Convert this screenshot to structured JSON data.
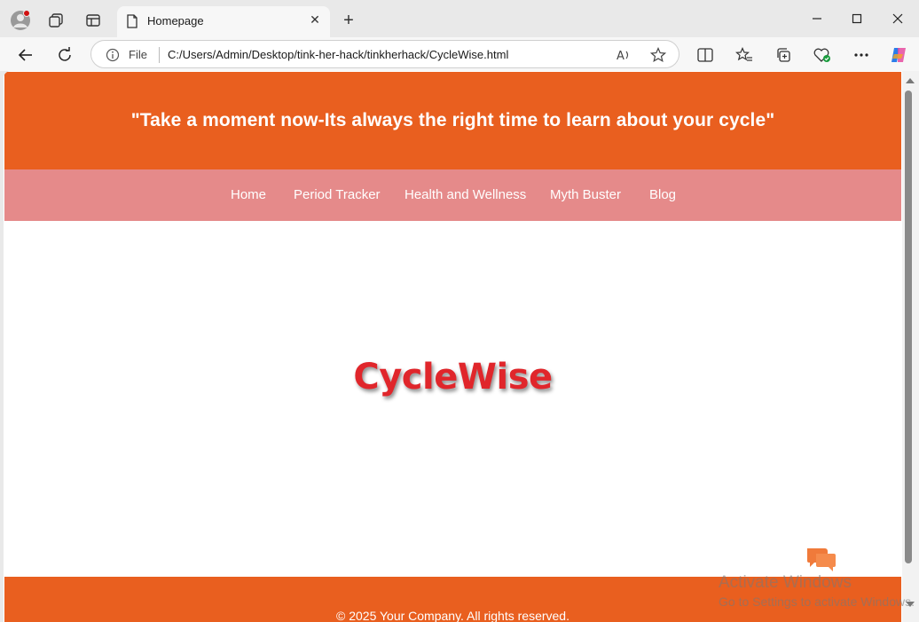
{
  "browser": {
    "tab_title": "Homepage",
    "address": {
      "scheme_label": "File",
      "url": "C:/Users/Admin/Desktop/tink-her-hack/tinkherhack/CycleWise.html"
    }
  },
  "page": {
    "hero_quote": "\"Take a moment now-Its always the right time to learn about your cycle\"",
    "nav": [
      {
        "label": "Home"
      },
      {
        "label": "Period Tracker"
      },
      {
        "label": "Health and Wellness"
      },
      {
        "label": "Myth Buster"
      },
      {
        "label": "Blog"
      }
    ],
    "brand": "CycleWise",
    "footer": "© 2025 Your Company. All rights reserved."
  },
  "overlay": {
    "watermark_title": "Activate Windows",
    "watermark_sub": "Go to Settings to activate Windows."
  },
  "colors": {
    "hero": "#e95f1f",
    "navbar": "#e58a8a",
    "brand": "#e0262b"
  }
}
